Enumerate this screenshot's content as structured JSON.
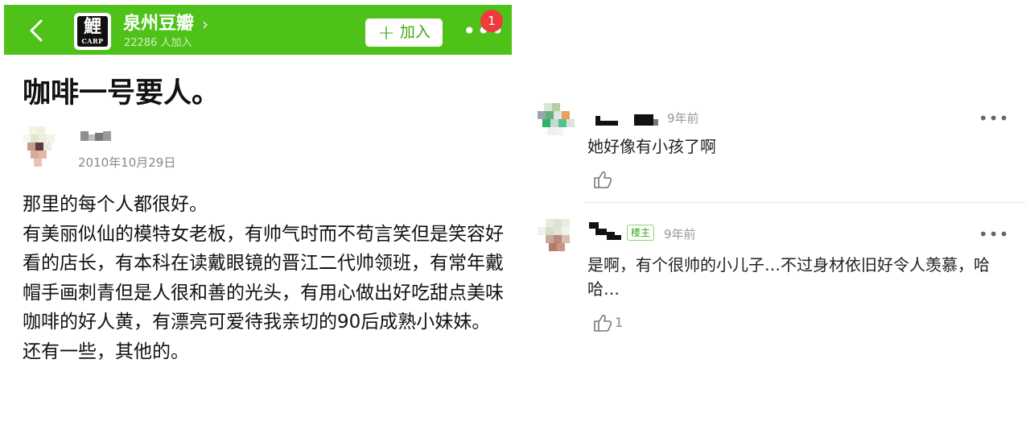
{
  "colors": {
    "brand": "#4fc21a",
    "badge": "#ef3b3b",
    "tag": "#38a81e"
  },
  "header": {
    "back_icon": "chevron-left-icon",
    "logo_char": "鯉",
    "logo_word": "CARP",
    "group_name": "泉州豆瓣",
    "group_chevron": "›",
    "members": "22286 人加入",
    "join_label": "加入",
    "more_icon": "•••",
    "badge_count": "1"
  },
  "post": {
    "title": "咖啡一号要人。",
    "date": "2010年10月29日",
    "paragraphs": [
      "那里的每个人都很好。",
      "有美丽似仙的模特女老板，有帅气时而不苟言笑但是笑容好看的店长，有本科在读戴眼镜的晋江二代帅领班，有常年戴帽手画刺青但是人很和善的光头，有用心做出好吃甜点美味咖啡的好人黄，有漂亮可爱待我亲切的90后成熟小妹妹。还有一些，其他的。"
    ]
  },
  "comments": [
    {
      "time": "9年前",
      "text": "她好像有小孩了啊",
      "like_count": ""
    },
    {
      "tag": "楼主",
      "time": "9年前",
      "text": "是啊，有个很帅的小儿子…不过身材依旧好令人羡慕，哈哈…",
      "like_count": "1"
    }
  ]
}
